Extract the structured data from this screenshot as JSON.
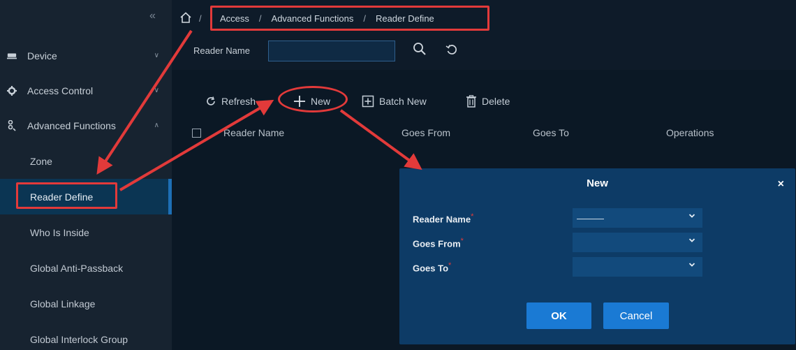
{
  "sidebar": {
    "collapse_glyph": "«",
    "items": [
      {
        "label": "Device",
        "icon": "device-icon",
        "chevron": "∨"
      },
      {
        "label": "Access Control",
        "icon": "gear-icon",
        "chevron": "∨"
      },
      {
        "label": "Advanced Functions",
        "icon": "advanced-functions-icon",
        "chevron": "∧"
      }
    ],
    "sub_items": [
      {
        "label": "Zone"
      },
      {
        "label": "Reader Define"
      },
      {
        "label": "Who Is Inside"
      },
      {
        "label": "Global Anti-Passback"
      },
      {
        "label": "Global Linkage"
      },
      {
        "label": "Global Interlock Group"
      }
    ]
  },
  "breadcrumb": {
    "separator": "/",
    "items": [
      "Access",
      "Advanced Functions",
      "Reader Define"
    ]
  },
  "search": {
    "label": "Reader Name",
    "value": ""
  },
  "toolbar": {
    "refresh_label": "Refresh",
    "new_label": "New",
    "batch_new_label": "Batch New",
    "delete_label": "Delete"
  },
  "table": {
    "columns": [
      "Reader Name",
      "Goes From",
      "Goes To",
      "Operations"
    ]
  },
  "dialog": {
    "title": "New",
    "close_glyph": "×",
    "required_mark": "*",
    "fields": [
      {
        "label": "Reader Name",
        "value": "———"
      },
      {
        "label": "Goes From",
        "value": ""
      },
      {
        "label": "Goes To",
        "value": ""
      }
    ],
    "ok_label": "OK",
    "cancel_label": "Cancel"
  },
  "colors": {
    "annotation": "#e23a3a",
    "accent": "#1a7ad4",
    "dialog_bg": "#0d3b66"
  }
}
